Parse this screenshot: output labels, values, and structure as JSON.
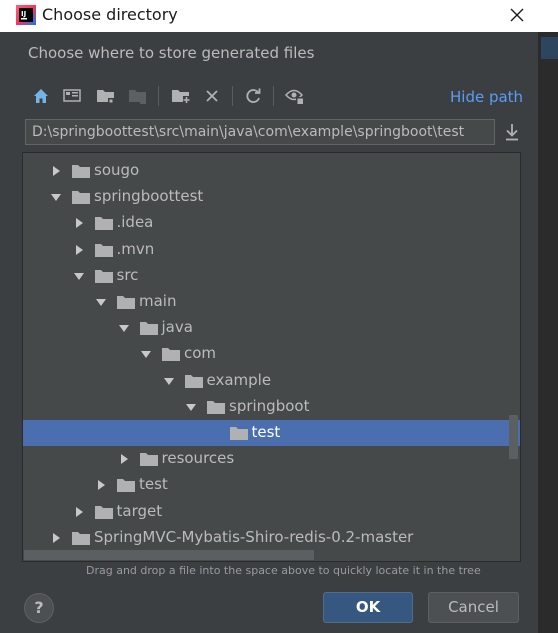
{
  "window": {
    "title": "Choose directory"
  },
  "dialog": {
    "description": "Choose where to store generated files",
    "hide_path_label": "Hide path",
    "path_value": "D:\\springboottest\\src\\main\\java\\com\\example\\springboot\\test",
    "hint": "Drag and drop a file into the space above to quickly locate it in the tree",
    "help_label": "?",
    "ok_label": "OK",
    "cancel_label": "Cancel"
  },
  "toolbar": {
    "icons": [
      "home-icon",
      "desktop-icon",
      "project-folder-icon",
      "module-folder-icon",
      "new-folder-icon",
      "delete-icon",
      "refresh-icon",
      "show-hidden-icon"
    ]
  },
  "tree": {
    "rows": [
      {
        "label": "sougo",
        "level": 1,
        "state": "collapsed"
      },
      {
        "label": "springboottest",
        "level": 1,
        "state": "expanded"
      },
      {
        "label": ".idea",
        "level": 2,
        "state": "collapsed"
      },
      {
        "label": ".mvn",
        "level": 2,
        "state": "collapsed"
      },
      {
        "label": "src",
        "level": 2,
        "state": "expanded"
      },
      {
        "label": "main",
        "level": 3,
        "state": "expanded"
      },
      {
        "label": "java",
        "level": 4,
        "state": "expanded"
      },
      {
        "label": "com",
        "level": 5,
        "state": "expanded"
      },
      {
        "label": "example",
        "level": 6,
        "state": "expanded"
      },
      {
        "label": "springboot",
        "level": 7,
        "state": "expanded"
      },
      {
        "label": "test",
        "level": 8,
        "state": "leaf",
        "selected": true
      },
      {
        "label": "resources",
        "level": 4,
        "state": "collapsed"
      },
      {
        "label": "test",
        "level": 3,
        "state": "collapsed"
      },
      {
        "label": "target",
        "level": 2,
        "state": "collapsed"
      },
      {
        "label": "SpringMVC-Mybatis-Shiro-redis-0.2-master",
        "level": 1,
        "state": "collapsed"
      }
    ]
  },
  "colors": {
    "background": "#3c3f41",
    "tree_background": "#45494a",
    "selection": "#4b6eaf",
    "link": "#589df6",
    "ok_button": "#365880"
  }
}
